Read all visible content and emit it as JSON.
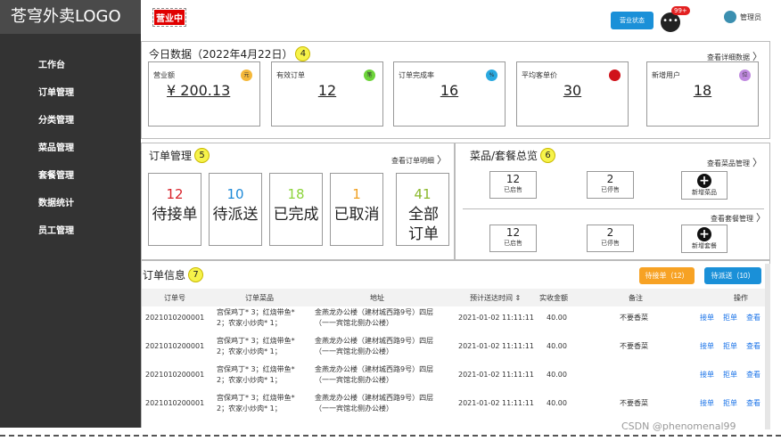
{
  "logo": "苍穹外卖LOGO",
  "sidebar": {
    "items": [
      {
        "label": "工作台"
      },
      {
        "label": "订单管理"
      },
      {
        "label": "分类管理"
      },
      {
        "label": "菜品管理"
      },
      {
        "label": "套餐管理"
      },
      {
        "label": "数据统计"
      },
      {
        "label": "员工管理"
      }
    ]
  },
  "header": {
    "status_badge": "营业中",
    "status_button": "营业状态",
    "message_count": "99+",
    "message_icon": "chat-bubble-icon",
    "admin_label": "管理员"
  },
  "today": {
    "title": "今日数据（2022年4月22日）",
    "marker": "4",
    "more": "查看详细数据",
    "cards": [
      {
        "label": "营业额",
        "value": "¥ 200.13",
        "icon_text": "元",
        "color": "#f5b83a"
      },
      {
        "label": "有效订单",
        "value": "12",
        "icon_text": "笔",
        "color": "#6dd43a"
      },
      {
        "label": "订单完成率",
        "value": "16",
        "icon_text": "%",
        "color": "#2aa9e0"
      },
      {
        "label": "平均客单价",
        "value": "30",
        "icon_text": "",
        "color": "#d0121a"
      },
      {
        "label": "新增用户",
        "value": "18",
        "icon_text": "位",
        "color": "#c08ae0"
      }
    ]
  },
  "order_mgmt": {
    "title": "订单管理",
    "marker": "5",
    "more": "查看订单明细",
    "boxes": [
      {
        "num": "12",
        "label": "待接单",
        "color": "#d8222a"
      },
      {
        "num": "10",
        "label": "待派送",
        "color": "#1f8ad8"
      },
      {
        "num": "18",
        "label": "已完成",
        "color": "#8cd43a"
      },
      {
        "num": "1",
        "label": "已取消",
        "color": "#f0a020"
      },
      {
        "num": "41",
        "label": "全部订单",
        "color": "#8ab82a"
      }
    ]
  },
  "dish": {
    "title": "菜品/套餐总览",
    "marker": "6",
    "dish_more": "查看菜品管理",
    "set_more": "查看套餐管理",
    "dish_on": {
      "num": "12",
      "label": "已启售"
    },
    "dish_off": {
      "num": "2",
      "label": "已停售"
    },
    "dish_add": "新增菜品",
    "set_on": {
      "num": "12",
      "label": "已启售"
    },
    "set_off": {
      "num": "2",
      "label": "已停售"
    },
    "set_add": "新增套餐"
  },
  "orders": {
    "title": "订单信息",
    "marker": "7",
    "btn_pending": "待接单（12）",
    "btn_delivery": "待派送（10）",
    "btn_pending_color": "#f7a224",
    "btn_delivery_color": "#1a90d8",
    "columns": [
      "订单号",
      "订单菜品",
      "地址",
      "预计送达时间 ⇕",
      "实收金额",
      "备注",
      "操作"
    ],
    "rows": [
      {
        "id": "2021010200001",
        "dish1": "宫保鸡丁* 3；红烧带鱼*",
        "dish2": "2；农家小炒肉* 1；",
        "addr1": "金燕龙办公楼（建材城西路9号）四层",
        "addr2": "（一一宾馆北侧办公楼）",
        "time": "2021-01-02 11:11:11",
        "amount": "40.00",
        "note": "不要香菜",
        "ops": [
          "接单",
          "拒单",
          "查看"
        ]
      },
      {
        "id": "2021010200001",
        "dish1": "宫保鸡丁* 3；红烧带鱼*",
        "dish2": "2；农家小炒肉* 1；",
        "addr1": "金燕龙办公楼（建材城西路9号）四层",
        "addr2": "（一一宾馆北侧办公楼）",
        "time": "2021-01-02 11:11:11",
        "amount": "40.00",
        "note": "不要香菜",
        "ops": [
          "接单",
          "拒单",
          "查看"
        ]
      },
      {
        "id": "2021010200001",
        "dish1": "宫保鸡丁* 3；红烧带鱼*",
        "dish2": "2；农家小炒肉* 1；",
        "addr1": "金燕龙办公楼（建材城西路9号）四层",
        "addr2": "（一一宾馆北侧办公楼）",
        "time": "2021-01-02 11:11:11",
        "amount": "40.00",
        "note": "",
        "ops": [
          "接单",
          "拒单",
          "查看"
        ]
      },
      {
        "id": "2021010200001",
        "dish1": "宫保鸡丁* 3；红烧带鱼*",
        "dish2": "2；农家小炒肉* 1；",
        "addr1": "金燕龙办公楼（建材城西路9号）四层",
        "addr2": "（一一宾馆北侧办公楼）",
        "time": "2021-01-02 11:11:11",
        "amount": "40.00",
        "note": "不要香菜",
        "ops": [
          "接单",
          "拒单",
          "查看"
        ]
      }
    ]
  },
  "watermark": "CSDN @phenomenal99"
}
